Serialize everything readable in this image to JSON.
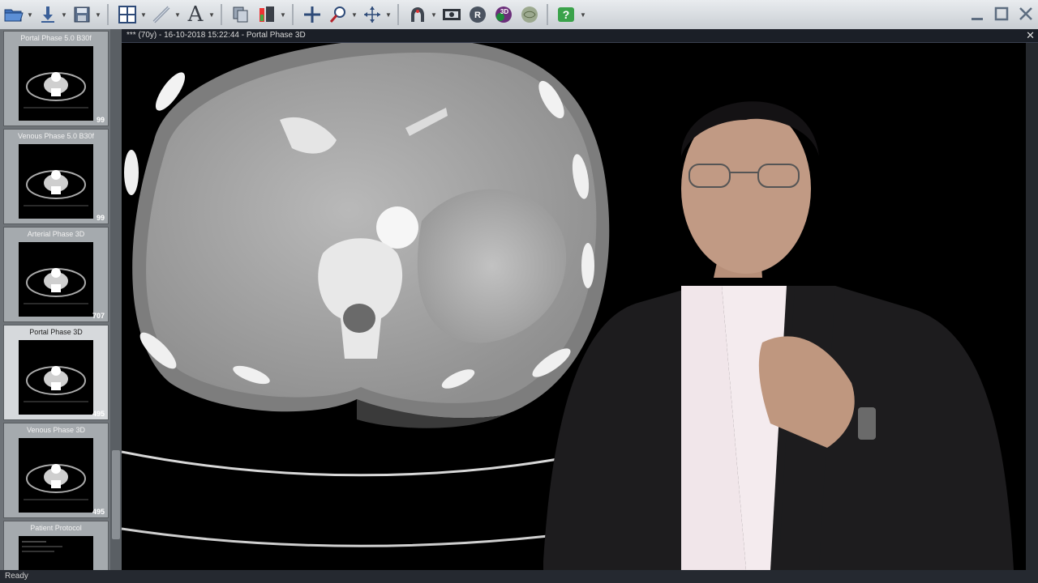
{
  "toolbar": {
    "icons": [
      "open-folder-icon",
      "download-icon",
      "save-icon",
      "layout-grid-icon",
      "measure-icon",
      "text-annotation-icon",
      "copy-icon",
      "window-level-icon",
      "crosshair-icon",
      "zoom-icon",
      "pan-icon",
      "mpr-icon",
      "screenshot-icon",
      "r-icon",
      "3d-icon",
      "globe-icon",
      "help-icon"
    ]
  },
  "window": {
    "controls": [
      "minimize",
      "maximize",
      "close"
    ]
  },
  "viewer": {
    "title": "*** (70y) - 16-10-2018 15:22:44 - Portal Phase 3D",
    "close_glyph": "✕"
  },
  "sidebar": {
    "series": [
      {
        "label": "Portal Phase 5.0 B30f",
        "count": "99"
      },
      {
        "label": "Venous Phase 5.0 B30f",
        "count": "99"
      },
      {
        "label": "Arterial Phase 3D",
        "count": "707"
      },
      {
        "label": "Portal Phase 3D",
        "count": "495"
      },
      {
        "label": "Venous Phase 3D",
        "count": "495"
      },
      {
        "label": "Patient Protocol",
        "count": ""
      }
    ]
  },
  "status": {
    "text": "Ready"
  },
  "colors": {
    "toolbar_bg": "#d7dbe0",
    "sidebar_bg": "#6e7378",
    "viewer_bg": "#000000"
  }
}
